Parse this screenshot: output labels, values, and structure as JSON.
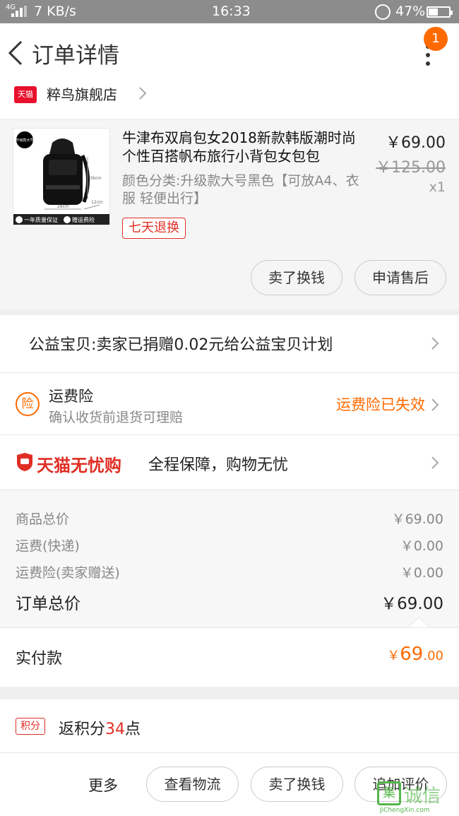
{
  "status_bar": {
    "network": "4G",
    "speed": "7 KB/s",
    "time": "16:33",
    "battery": "47%",
    "battery_level": 0.47
  },
  "header": {
    "title": "订单详情",
    "badge_count": "1"
  },
  "shop": {
    "badge": "天猫",
    "name": "粹鸟旗舰店"
  },
  "product": {
    "title": "牛津布双肩包女2018新款韩版潮时尚个性百搭帆布旅行小背包女包包",
    "price": "￥69.00",
    "original_price": "￥125.00",
    "quantity": "x1",
    "sku": "颜色分类:升级款大号黑色【可放A4、衣服 轻便出行】",
    "service_tag": "七天退换",
    "image_texts": {
      "corner_badge": "升级款大号",
      "height": "36cm",
      "width": "28cm",
      "depth": "12cm",
      "guarantee": "一年质量保证",
      "freight": "赠运费险"
    },
    "buttons": [
      "卖了换钱",
      "申请售后"
    ]
  },
  "charity": {
    "text": "公益宝贝:卖家已捐赠0.02元给公益宝贝计划"
  },
  "insurance": {
    "icon": "险",
    "title": "运费险",
    "subtitle": "确认收货前退货可理赔",
    "status": "运费险已失效"
  },
  "worry_free": {
    "brand": "天猫无忧购",
    "slogan": "全程保障，购物无忧"
  },
  "totals": {
    "rows": [
      {
        "label": "商品总价",
        "value": "￥69.00"
      },
      {
        "label": "运费(快递)",
        "value": "￥0.00"
      },
      {
        "label": "运费险(卖家赠送)",
        "value": "￥0.00"
      }
    ],
    "order_total_label": "订单总价",
    "order_total_value": "￥69.00"
  },
  "paid": {
    "label": "实付款",
    "currency": "￥",
    "integer": "69",
    "decimal": ".00"
  },
  "points": {
    "tag": "积分",
    "prefix": "返积分",
    "count": "34",
    "suffix": "点"
  },
  "bottom_bar": {
    "more": "更多",
    "buttons": [
      "查看物流",
      "卖了换钱",
      "追加评价"
    ]
  },
  "watermark": {
    "logo": "集",
    "text_cn": "诚信",
    "text_en": "JiChengXin.com"
  },
  "colors": {
    "accent": "#ff6a00",
    "tmall_red": "#e02e24",
    "status_bar": "#8c8c8c"
  }
}
